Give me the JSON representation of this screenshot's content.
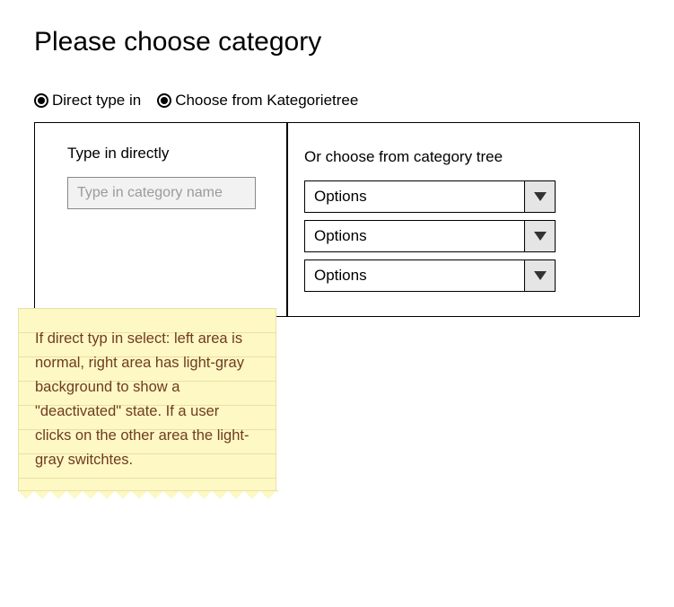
{
  "title": "Please choose category",
  "radios": {
    "direct": {
      "label": "Direct type in",
      "selected": true
    },
    "tree": {
      "label": "Choose from Kategorietree",
      "selected": true
    }
  },
  "left_panel": {
    "heading": "Type in directly",
    "placeholder": "Type in category name",
    "value": ""
  },
  "right_panel": {
    "heading": "Or choose from category tree",
    "selects": [
      {
        "label": "Options"
      },
      {
        "label": "Options"
      },
      {
        "label": "Options"
      }
    ]
  },
  "note": "If direct typ in select: left area is normal, right area has light-gray background to show a \"deactivated\" state. If a user clicks on the other area the light-gray switchtes."
}
